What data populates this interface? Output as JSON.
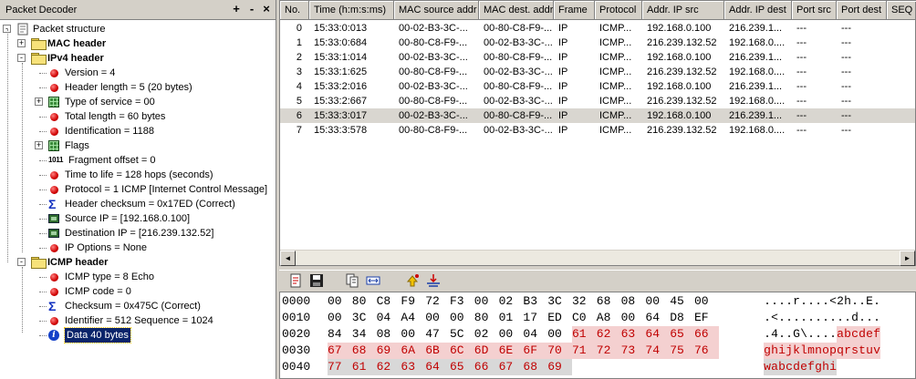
{
  "left_panel": {
    "title": "Packet Decoder",
    "controls": {
      "add": "+",
      "remove": "-",
      "close": "×"
    },
    "tree": [
      {
        "label": "Packet structure",
        "icon": "document-icon",
        "expander": "-"
      },
      {
        "label": "MAC header",
        "icon": "folder-icon",
        "expander": "+",
        "bold": true
      },
      {
        "label": "IPv4 header",
        "icon": "folder-icon",
        "expander": "-",
        "bold": true
      },
      {
        "label": "Version = 4",
        "icon": "red-dot-icon"
      },
      {
        "label": "Header length = 5 (20 bytes)",
        "icon": "red-dot-icon"
      },
      {
        "label": "Type of service = 00",
        "icon": "grid-icon",
        "expander": "+"
      },
      {
        "label": "Total length = 60 bytes",
        "icon": "red-dot-icon"
      },
      {
        "label": "Identification = 1188",
        "icon": "red-dot-icon"
      },
      {
        "label": "Flags",
        "icon": "grid-icon",
        "expander": "+"
      },
      {
        "label": "Fragment offset = 0",
        "icon": "binary-icon",
        "icon_text": "1011"
      },
      {
        "label": "Time to life = 128 hops (seconds)",
        "icon": "red-dot-icon"
      },
      {
        "label": "Protocol = 1 ICMP [Internet Control Message]",
        "icon": "red-dot-icon"
      },
      {
        "label": "Header checksum = 0x17ED (Correct)",
        "icon": "sigma-icon",
        "icon_text": "Σ"
      },
      {
        "label": "Source  IP = [192.168.0.100]",
        "icon": "computer-icon"
      },
      {
        "label": "Destination IP = [216.239.132.52]",
        "icon": "computer-icon"
      },
      {
        "label": "IP Options = None",
        "icon": "red-dot-icon"
      },
      {
        "label": "ICMP header",
        "icon": "folder-icon",
        "expander": "-",
        "bold": true
      },
      {
        "label": "ICMP type = 8 Echo",
        "icon": "red-dot-icon"
      },
      {
        "label": "ICMP code = 0",
        "icon": "red-dot-icon"
      },
      {
        "label": "Checksum = 0x475C (Correct)",
        "icon": "sigma-icon",
        "icon_text": "Σ"
      },
      {
        "label": "Identifier = 512 Sequence = 1024",
        "icon": "red-dot-icon"
      },
      {
        "label": "Data 40 bytes",
        "icon": "info-icon",
        "icon_text": "i",
        "selected": true
      }
    ]
  },
  "packet_table": {
    "columns": [
      "No.",
      "Time (h:m:s:ms)",
      "MAC source addr",
      "MAC dest. addr",
      "Frame",
      "Protocol",
      "Addr. IP src",
      "Addr. IP dest",
      "Port src",
      "Port dest",
      "SEQ"
    ],
    "rows": [
      [
        "0",
        "15:33:0:013",
        "00-02-B3-3C-...",
        "00-80-C8-F9-...",
        "IP",
        "ICMP...",
        "192.168.0.100",
        "216.239.1...",
        "---",
        "---",
        ""
      ],
      [
        "1",
        "15:33:0:684",
        "00-80-C8-F9-...",
        "00-02-B3-3C-...",
        "IP",
        "ICMP...",
        "216.239.132.52",
        "192.168.0....",
        "---",
        "---",
        ""
      ],
      [
        "2",
        "15:33:1:014",
        "00-02-B3-3C-...",
        "00-80-C8-F9-...",
        "IP",
        "ICMP...",
        "192.168.0.100",
        "216.239.1...",
        "---",
        "---",
        ""
      ],
      [
        "3",
        "15:33:1:625",
        "00-80-C8-F9-...",
        "00-02-B3-3C-...",
        "IP",
        "ICMP...",
        "216.239.132.52",
        "192.168.0....",
        "---",
        "---",
        ""
      ],
      [
        "4",
        "15:33:2:016",
        "00-02-B3-3C-...",
        "00-80-C8-F9-...",
        "IP",
        "ICMP...",
        "192.168.0.100",
        "216.239.1...",
        "---",
        "---",
        ""
      ],
      [
        "5",
        "15:33:2:667",
        "00-80-C8-F9-...",
        "00-02-B3-3C-...",
        "IP",
        "ICMP...",
        "216.239.132.52",
        "192.168.0....",
        "---",
        "---",
        ""
      ],
      [
        "6",
        "15:33:3:017",
        "00-02-B3-3C-...",
        "00-80-C8-F9-...",
        "IP",
        "ICMP...",
        "192.168.0.100",
        "216.239.1...",
        "---",
        "---",
        ""
      ],
      [
        "7",
        "15:33:3:578",
        "00-80-C8-F9-...",
        "00-02-B3-3C-...",
        "IP",
        "ICMP...",
        "216.239.132.52",
        "192.168.0....",
        "---",
        "---",
        ""
      ]
    ],
    "selected_row": 6
  },
  "scrollbar": {
    "left_arrow": "◄",
    "right_arrow": "►"
  },
  "toolbar": {
    "buttons": [
      "new-document-icon",
      "save-icon",
      "copy-icon",
      "expand-width-icon",
      "up-arrow-icon",
      "filter-icon"
    ]
  },
  "hex_view": {
    "rows": [
      {
        "offset": "0000",
        "bytes": [
          "00",
          "80",
          "C8",
          "F9",
          "72",
          "F3",
          "00",
          "02",
          "B3",
          "3C",
          "32",
          "68",
          "08",
          "00",
          "45",
          "00"
        ],
        "ascii": "....r....<2h..E."
      },
      {
        "offset": "0010",
        "bytes": [
          "00",
          "3C",
          "04",
          "A4",
          "00",
          "00",
          "80",
          "01",
          "17",
          "ED",
          "C0",
          "A8",
          "00",
          "64",
          "D8",
          "EF"
        ],
        "ascii": ".<..........d..."
      },
      {
        "offset": "0020",
        "bytes": [
          "84",
          "34",
          "08",
          "00",
          "47",
          "5C",
          "02",
          "00",
          "04",
          "00",
          "61",
          "62",
          "63",
          "64",
          "65",
          "66"
        ],
        "ascii": ".4..G\\....abcdef"
      },
      {
        "offset": "0030",
        "bytes": [
          "67",
          "68",
          "69",
          "6A",
          "6B",
          "6C",
          "6D",
          "6E",
          "6F",
          "70",
          "71",
          "72",
          "73",
          "74",
          "75",
          "76"
        ],
        "ascii": "ghijklmnopqrstuv"
      },
      {
        "offset": "0040",
        "bytes": [
          "77",
          "61",
          "62",
          "63",
          "64",
          "65",
          "66",
          "67",
          "68",
          "69"
        ],
        "ascii": "wabcdefghi"
      }
    ],
    "highlight_color": "#c00000"
  }
}
